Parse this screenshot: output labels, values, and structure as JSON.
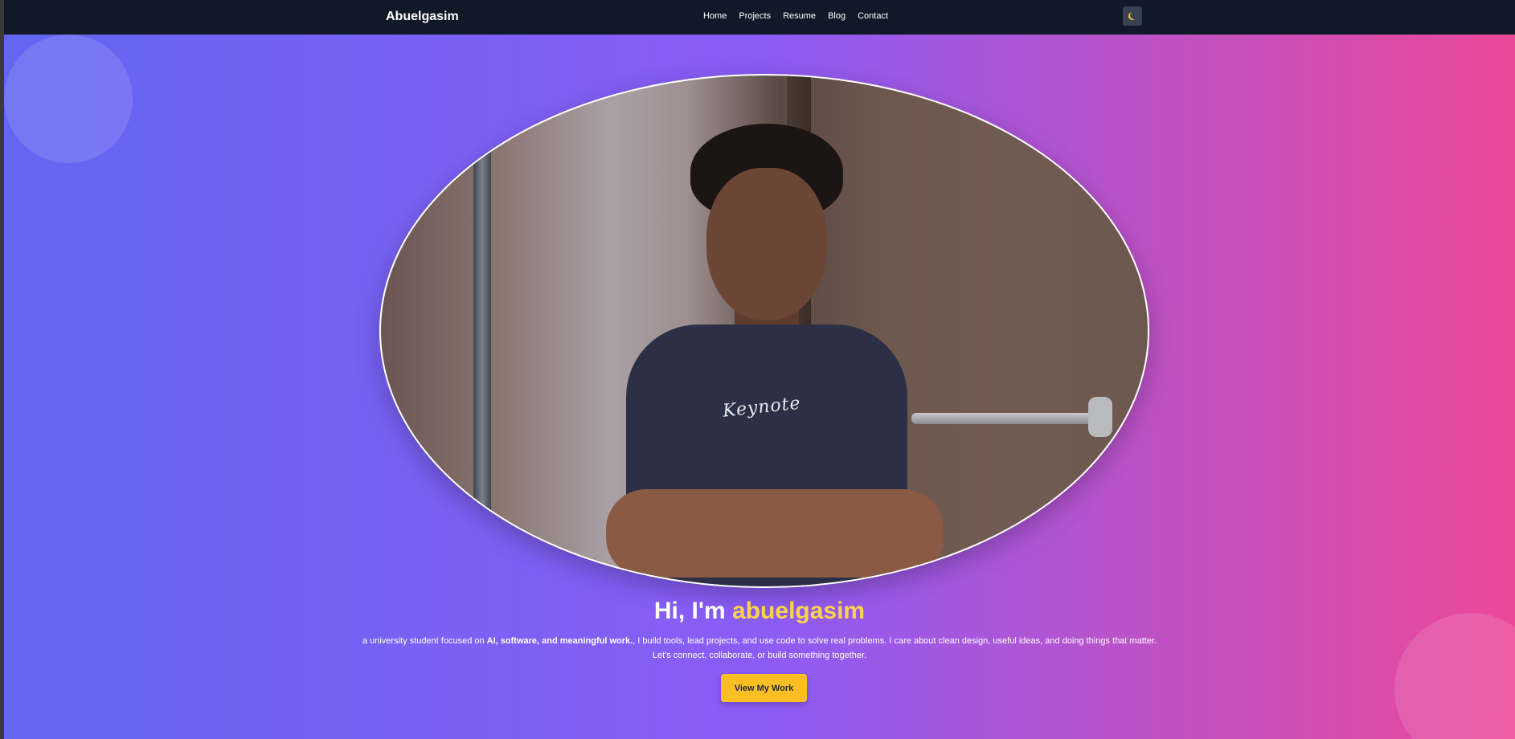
{
  "nav": {
    "brand": "Abuelgasim",
    "links": [
      "Home",
      "Projects",
      "Resume",
      "Blog",
      "Contact"
    ],
    "theme_toggle_icon": "moon-icon"
  },
  "hero": {
    "greeting": "Hi, I'm",
    "name": "abuelgasim",
    "desc_prefix": "a university student focused on ",
    "desc_bold": "AI, software, and meaningful work.",
    "desc_rest": ", I build tools, lead projects, and use code to solve real problems. I care about clean design, useful ideas, and doing things that matter.",
    "desc_line2": "Let's connect, collaborate, or build something together.",
    "cta_label": "View My Work",
    "shirt_text": "Keynote"
  },
  "colors": {
    "nav_bg": "#111827",
    "gradient_start": "#6366f1",
    "gradient_mid": "#8b5cf6",
    "gradient_end": "#ec4899",
    "accent": "#fcd34d",
    "cta_bg": "#fbbf24"
  }
}
